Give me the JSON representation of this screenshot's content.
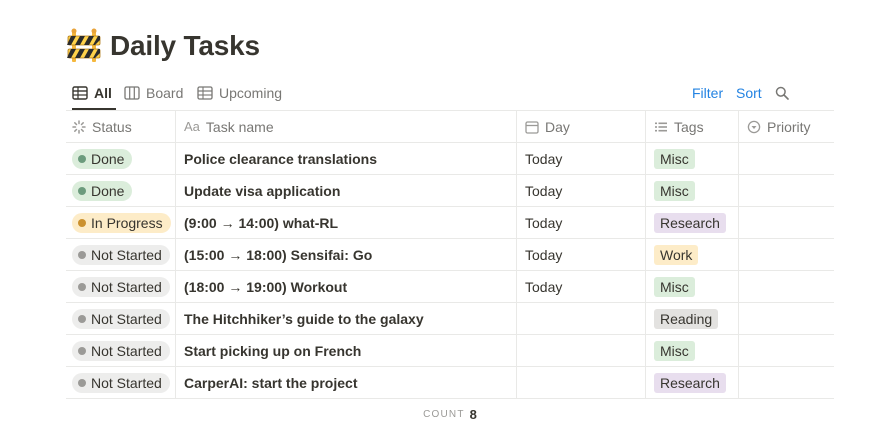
{
  "page": {
    "title": "Daily Tasks",
    "icon": "construction-barrier-icon"
  },
  "views": {
    "tabs": [
      {
        "label": "All",
        "icon": "table-icon",
        "active": true
      },
      {
        "label": "Board",
        "icon": "board-icon",
        "active": false
      },
      {
        "label": "Upcoming",
        "icon": "table-icon",
        "active": false
      }
    ],
    "filter_label": "Filter",
    "sort_label": "Sort",
    "search_icon": "search-icon"
  },
  "table": {
    "columns": [
      {
        "label": "Status",
        "icon": "status-icon"
      },
      {
        "label": "Task name",
        "icon": "text-icon",
        "icon_text": "Aa"
      },
      {
        "label": "Day",
        "icon": "calendar-icon"
      },
      {
        "label": "Tags",
        "icon": "list-icon"
      },
      {
        "label": "Priority",
        "icon": "priority-icon"
      }
    ],
    "rows": [
      {
        "status": "Done",
        "name": "Police clearance translations",
        "day": "Today",
        "tag": "Misc",
        "priority": ""
      },
      {
        "status": "Done",
        "name": "Update visa application",
        "day": "Today",
        "tag": "Misc",
        "priority": ""
      },
      {
        "status": "In Progress",
        "name": "(9:00 → 14:00) what-RL",
        "day": "Today",
        "tag": "Research",
        "priority": ""
      },
      {
        "status": "Not Started",
        "name": "(15:00 → 18:00) Sensifai: Go",
        "day": "Today",
        "tag": "Work",
        "priority": ""
      },
      {
        "status": "Not Started",
        "name": "(18:00 → 19:00) Workout",
        "day": "Today",
        "tag": "Misc",
        "priority": ""
      },
      {
        "status": "Not Started",
        "name": "The Hitchhiker’s guide to the galaxy",
        "day": "",
        "tag": "Reading",
        "priority": ""
      },
      {
        "status": "Not Started",
        "name": "Start picking up on French",
        "day": "",
        "tag": "Misc",
        "priority": ""
      },
      {
        "status": "Not Started",
        "name": "CarperAI: start the project",
        "day": "",
        "tag": "Research",
        "priority": ""
      }
    ]
  },
  "footer": {
    "count_label": "COUNT",
    "count_value": "8"
  },
  "colors": {
    "accent": "#2383e2",
    "status": {
      "Done": {
        "bg": "#dbeddb",
        "dot": "#6c9b7d"
      },
      "In Progress": {
        "bg": "#fdecc8",
        "dot": "#cb912f"
      },
      "Not Started": {
        "bg": "#ededec",
        "dot": "#9b9a97"
      }
    },
    "tags": {
      "Misc": "#dbeddb",
      "Research": "#e8deee",
      "Work": "#fdecc8",
      "Reading": "#e3e2e0"
    }
  }
}
